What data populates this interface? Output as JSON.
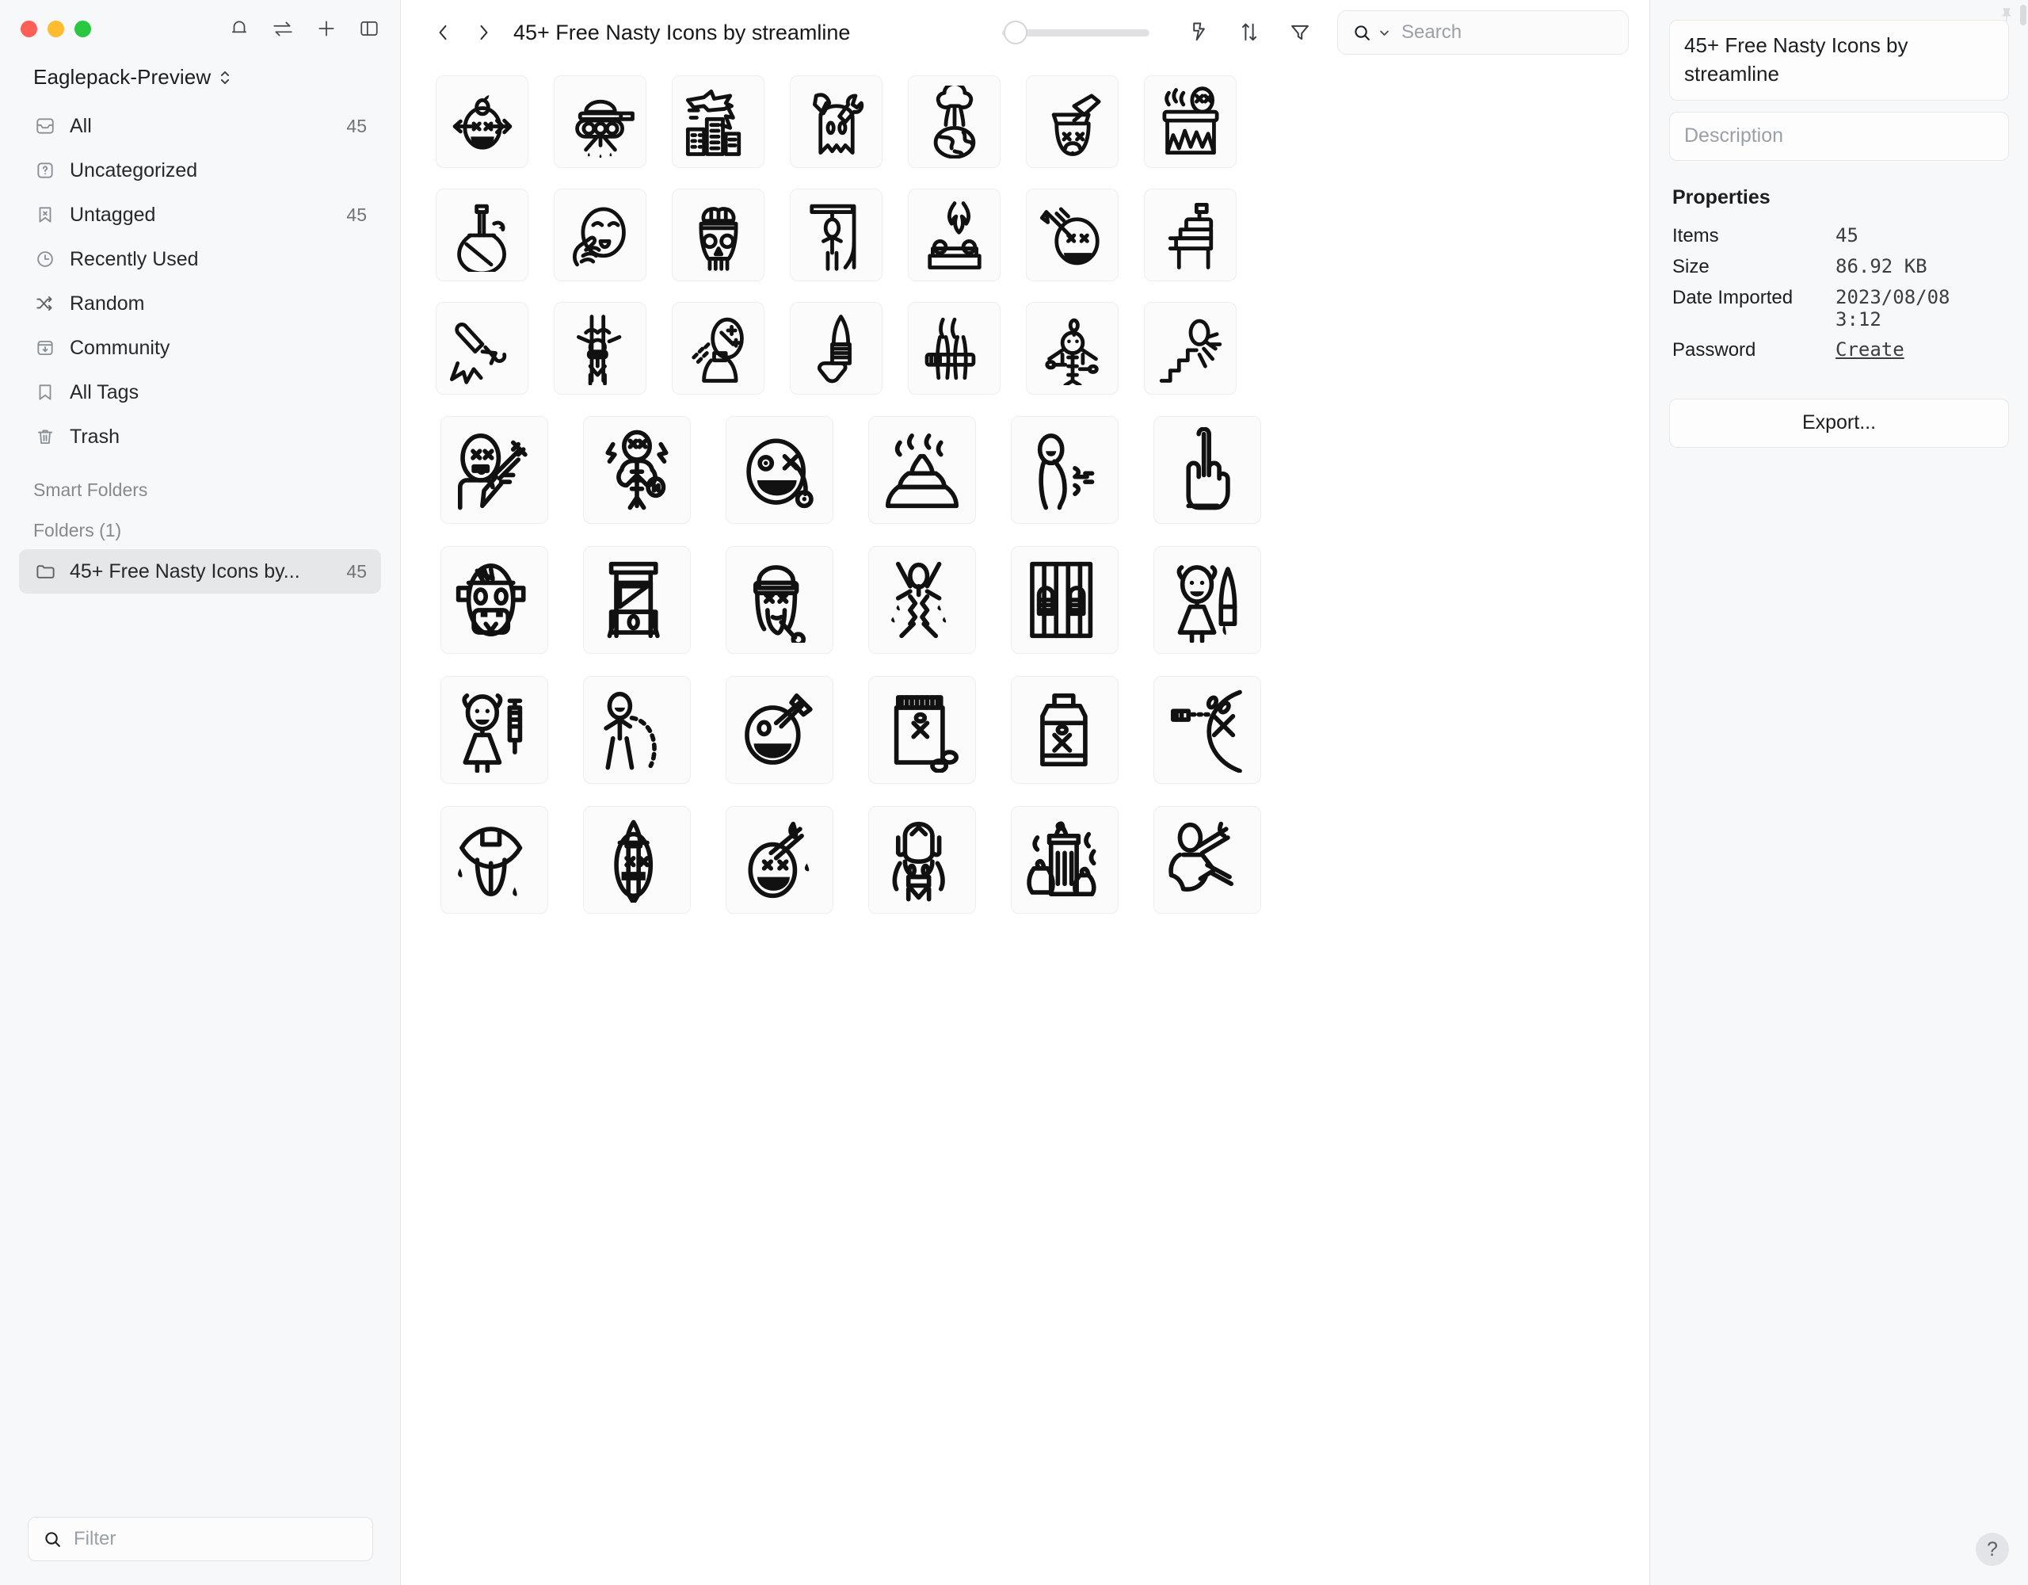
{
  "window": {
    "traffic_lights": [
      "close",
      "minimize",
      "zoom"
    ],
    "actions": [
      {
        "name": "notifications-icon",
        "label": "Notifications"
      },
      {
        "name": "sync-icon",
        "label": "Sync"
      },
      {
        "name": "add-icon",
        "label": "Add"
      },
      {
        "name": "toggle-sidebar-icon",
        "label": "Toggle Sidebar"
      }
    ]
  },
  "sidebar": {
    "library_name": "Eaglepack-Preview",
    "items": [
      {
        "label": "All",
        "count": "45",
        "icon": "inbox-icon",
        "active": false
      },
      {
        "label": "Uncategorized",
        "count": "",
        "icon": "question-square-icon",
        "active": false
      },
      {
        "label": "Untagged",
        "count": "45",
        "icon": "bookmark-x-icon",
        "active": false
      },
      {
        "label": "Recently Used",
        "count": "",
        "icon": "clock-icon",
        "active": false
      },
      {
        "label": "Random",
        "count": "",
        "icon": "shuffle-icon",
        "active": false
      },
      {
        "label": "Community",
        "count": "",
        "icon": "download-window-icon",
        "active": false
      },
      {
        "label": "All Tags",
        "count": "",
        "icon": "bookmark-icon",
        "active": false
      },
      {
        "label": "Trash",
        "count": "",
        "icon": "trash-icon",
        "active": false
      }
    ],
    "smart_folders_header": "Smart Folders",
    "folders_header": "Folders (1)",
    "folders": [
      {
        "label": "45+ Free Nasty Icons by...",
        "count": "45",
        "icon": "folder-icon",
        "active": true
      }
    ],
    "filter_placeholder": "Filter"
  },
  "toolbar": {
    "back_label": "Back",
    "forward_label": "Forward",
    "breadcrumb_title": "45+ Free Nasty Icons by streamline",
    "zoom_slider_value": 4,
    "zoom_slider_min": 0,
    "zoom_slider_max": 100,
    "icons": [
      {
        "name": "lightning-icon",
        "label": "Quick Actions"
      },
      {
        "name": "sort-icon",
        "label": "Sort"
      },
      {
        "name": "filter-funnel-icon",
        "label": "Filter"
      }
    ],
    "search_placeholder": "Search"
  },
  "grid": {
    "rows": [
      {
        "cols": 7,
        "items": [
          {
            "name": "arrow-through-head-apple",
            "label": "Apple shot arrow head"
          },
          {
            "name": "tank-bombing",
            "label": "Tank dropping bombs"
          },
          {
            "name": "airstrike-city",
            "label": "Airstrike on city"
          },
          {
            "name": "axe-wrench-ghost",
            "label": "Axe and wrench"
          },
          {
            "name": "nuclear-explosion-earth",
            "label": "Nuclear explosion earth"
          },
          {
            "name": "axe-in-head",
            "label": "Axe in head"
          },
          {
            "name": "head-on-fire-pot",
            "label": "Head boiling over fire"
          }
        ]
      },
      {
        "cols": 7,
        "items": [
          {
            "name": "bong-pipe",
            "label": "Bong"
          },
          {
            "name": "hand-pinching-face",
            "label": "Hand pinching face"
          },
          {
            "name": "skull-brain",
            "label": "Skull with brain"
          },
          {
            "name": "gallows-hanging",
            "label": "Gallows"
          },
          {
            "name": "burning-body-table",
            "label": "Body burning on table"
          },
          {
            "name": "cigarette-face",
            "label": "Cigarette and dead face"
          },
          {
            "name": "electric-chair",
            "label": "Electric chair"
          }
        ]
      },
      {
        "cols": 7,
        "items": [
          {
            "name": "broken-bone",
            "label": "Broken bone"
          },
          {
            "name": "person-tied-to-pole",
            "label": "Person tied to pole"
          },
          {
            "name": "spray-bottle-face",
            "label": "Spray bottle to face"
          },
          {
            "name": "knife-blade",
            "label": "Knife"
          },
          {
            "name": "legs-in-stocks",
            "label": "Legs in stocks"
          },
          {
            "name": "voodoo-doll-pins",
            "label": "Voodoo doll with pins"
          },
          {
            "name": "fall-down-stairs",
            "label": "Falling down stairs"
          }
        ]
      },
      {
        "cols": 6,
        "items": [
          {
            "name": "dead-face-syringe",
            "label": "Dead face with syringe"
          },
          {
            "name": "voodoo-doll-shock",
            "label": "Shocked voodoo doll"
          },
          {
            "name": "dead-face-eyepatch",
            "label": "Dead face with eyepatch"
          },
          {
            "name": "poop-steaming",
            "label": "Steaming poop"
          },
          {
            "name": "person-farting",
            "label": "Person farting"
          },
          {
            "name": "middle-finger",
            "label": "Middle finger"
          }
        ]
      },
      {
        "cols": 6,
        "items": [
          {
            "name": "frankenstein-head",
            "label": "Frankenstein head"
          },
          {
            "name": "guillotine",
            "label": "Guillotine"
          },
          {
            "name": "dead-girl-hair",
            "label": "Dead face with long hair"
          },
          {
            "name": "person-torn-apart",
            "label": "Person torn apart"
          },
          {
            "name": "prison-bars-hands",
            "label": "Hands on prison bars"
          },
          {
            "name": "girl-with-knife",
            "label": "Girl with knife"
          }
        ]
      },
      {
        "cols": 6,
        "items": [
          {
            "name": "girl-with-syringe",
            "label": "Girl with syringe"
          },
          {
            "name": "person-vomiting",
            "label": "Person vomiting"
          },
          {
            "name": "face-with-cleaver",
            "label": "Face with cleaver"
          },
          {
            "name": "poison-pill-bottle",
            "label": "Poison pill bottle"
          },
          {
            "name": "poison-jug",
            "label": "Poison jug"
          },
          {
            "name": "gunshot-spray",
            "label": "Gunshot spray"
          }
        ]
      },
      {
        "cols": 6,
        "items": [
          {
            "name": "mouth-tongue-out",
            "label": "Mouth with tongue out"
          },
          {
            "name": "dead-face-dagger",
            "label": "Dead face pierced by dagger"
          },
          {
            "name": "face-sword-through",
            "label": "Face with sword through"
          },
          {
            "name": "topless-woman",
            "label": "Topless figure"
          },
          {
            "name": "smelly-trash-can",
            "label": "Smelly trash can"
          },
          {
            "name": "person-stabbed",
            "label": "Person stabbed"
          }
        ]
      }
    ]
  },
  "inspector": {
    "pin_icon": "pin-icon",
    "title": "45+ Free Nasty Icons by streamline",
    "description_placeholder": "Description",
    "properties_header": "Properties",
    "properties": [
      {
        "key": "Items",
        "value": "45",
        "is_link": false,
        "mono": true
      },
      {
        "key": "Size",
        "value": "86.92 KB",
        "is_link": false,
        "mono": true
      },
      {
        "key": "Date Imported",
        "value": "2023/08/08 3:12",
        "is_link": false,
        "mono": true
      },
      {
        "key": "Password",
        "value": "Create",
        "is_link": true,
        "mono": true
      }
    ],
    "export_label": "Export..."
  },
  "help": {
    "label": "?"
  },
  "colors": {
    "sidebar_bg": "#f7f8f9",
    "main_bg": "#ffffff",
    "tile_bg": "#fbfbfb",
    "tile_border": "#eeeeee",
    "active_item_bg": "#e6e7e9",
    "text_primary": "#1c1d1f",
    "text_secondary": "#6f7479",
    "placeholder": "#9aa0a6",
    "traffic_red": "#ff5f57",
    "traffic_yellow": "#febc2e",
    "traffic_green": "#28c840"
  }
}
